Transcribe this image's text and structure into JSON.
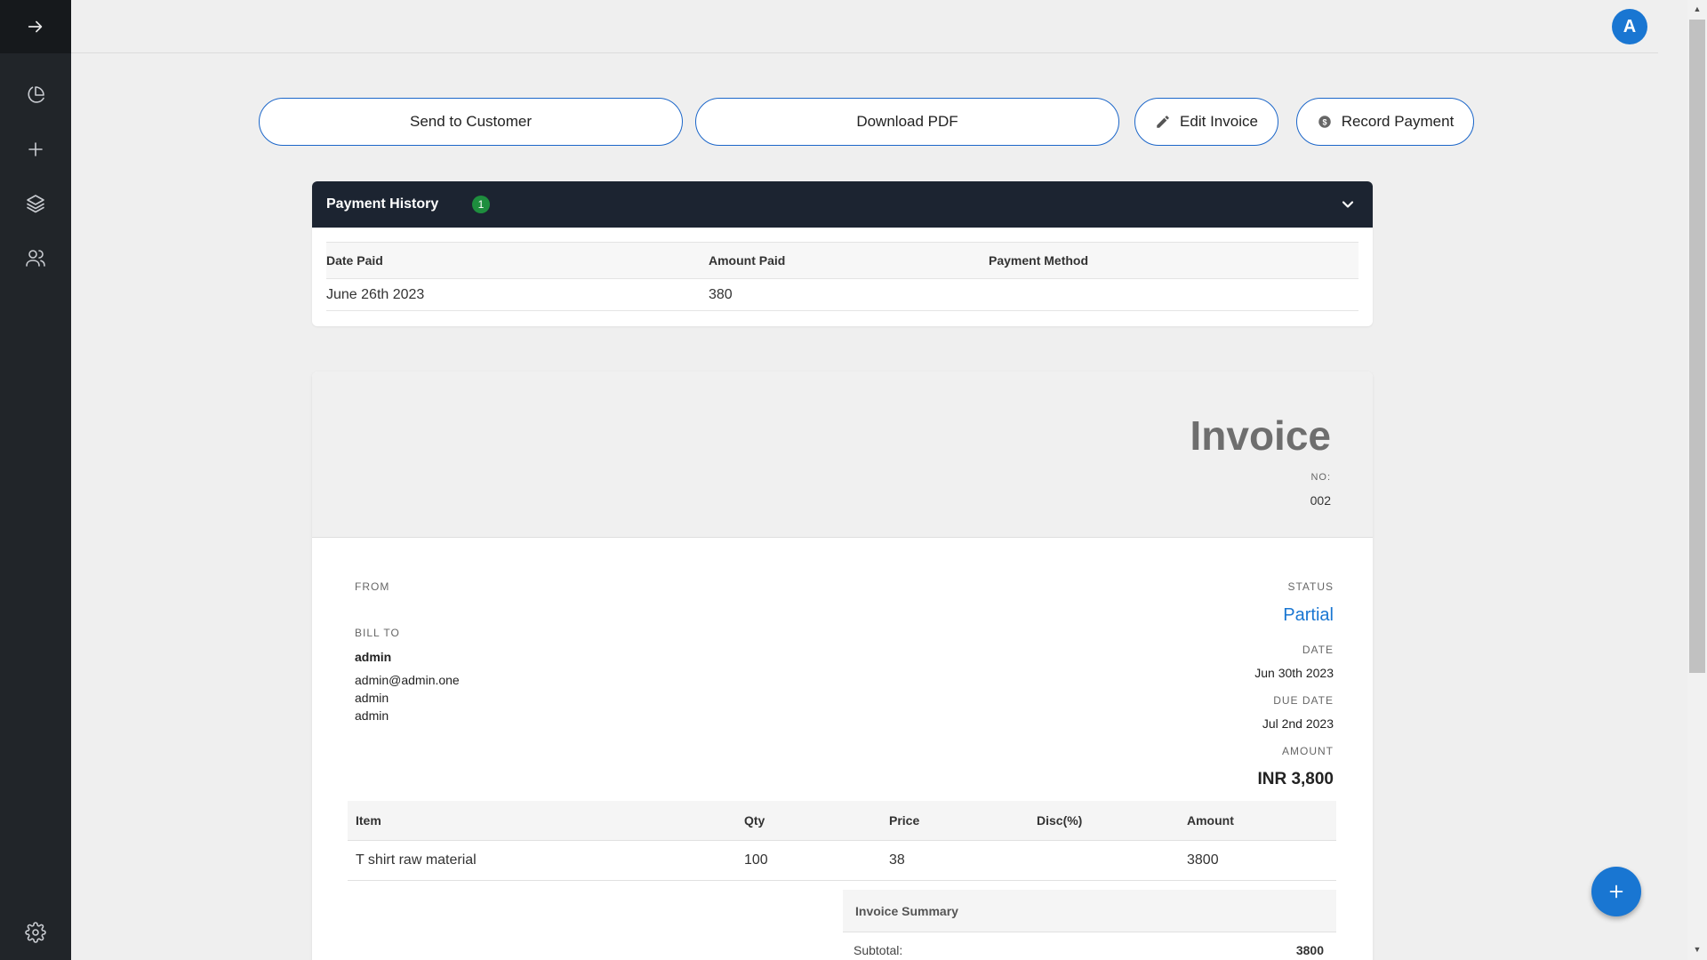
{
  "topbar": {
    "avatar_letter": "A"
  },
  "actions": {
    "send": "Send to Customer",
    "download": "Download PDF",
    "edit": "Edit Invoice",
    "record": "Record Payment"
  },
  "payment_history": {
    "title": "Payment History",
    "count": "1",
    "columns": [
      "Date Paid",
      "Amount Paid",
      "Payment Method"
    ],
    "rows": [
      {
        "date": "June 26th 2023",
        "amount": "380",
        "method": ""
      }
    ]
  },
  "invoice": {
    "title": "Invoice",
    "no_label": "NO:",
    "number": "002",
    "from_label": "FROM",
    "bill_to_label": "BILL TO",
    "bill_to": {
      "name": "admin",
      "email": "admin@admin.one",
      "line1": "admin",
      "line2": "admin"
    },
    "status_label": "STATUS",
    "status": "Partial",
    "date_label": "DATE",
    "date": "Jun 30th 2023",
    "due_label": "DUE DATE",
    "due": "Jul 2nd 2023",
    "amount_label": "AMOUNT",
    "amount": "INR 3,800",
    "item_columns": [
      "Item",
      "Qty",
      "Price",
      "Disc(%)",
      "Amount"
    ],
    "items": [
      {
        "item": "T shirt raw material",
        "qty": "100",
        "price": "38",
        "disc": "",
        "amount": "3800"
      }
    ],
    "summary": {
      "title": "Invoice Summary",
      "subtotal_label": "Subtotal:",
      "subtotal": "3800"
    }
  },
  "colors": {
    "accent": "#1976d2",
    "sidebar": "#212529",
    "header": "#1c2431",
    "badge": "#1e8e3e"
  }
}
